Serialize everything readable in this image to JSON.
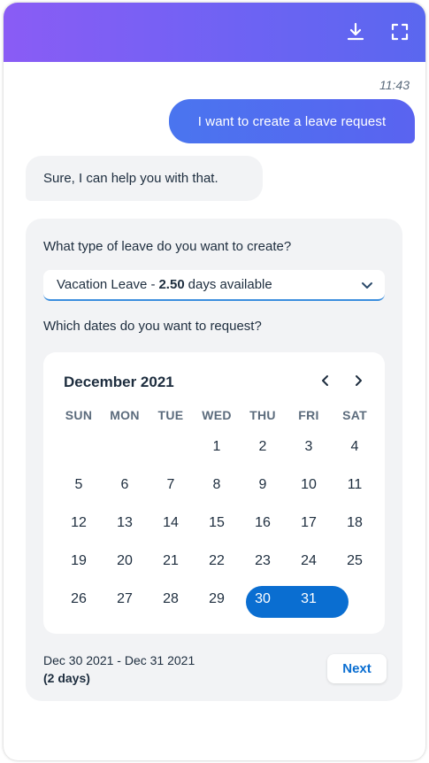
{
  "header": {
    "download_icon": "download-icon",
    "fullscreen_icon": "fullscreen-icon",
    "gradient_start": "#8a5cf5",
    "gradient_end": "#5a67ef"
  },
  "conversation": {
    "timestamp": "11:43",
    "user_message": "I want to create a leave request",
    "bot_message": "Sure, I can help you with that."
  },
  "form": {
    "leave_question": "What type of leave do you want to create?",
    "leave_select": {
      "type": "Vacation Leave -",
      "amount": "2.50",
      "suffix": "days available"
    },
    "dates_question": "Which dates do you want to request?",
    "calendar": {
      "month_label": "December 2021",
      "weekdays": [
        "SUN",
        "MON",
        "TUE",
        "WED",
        "THU",
        "FRI",
        "SAT"
      ],
      "weeks": [
        [
          "",
          "",
          "",
          "1",
          "2",
          "3",
          "4"
        ],
        [
          "5",
          "6",
          "7",
          "8",
          "9",
          "10",
          "11"
        ],
        [
          "12",
          "13",
          "14",
          "15",
          "16",
          "17",
          "18"
        ],
        [
          "19",
          "20",
          "21",
          "22",
          "23",
          "24",
          "25"
        ],
        [
          "26",
          "27",
          "28",
          "29",
          "30",
          "31",
          ""
        ]
      ],
      "selected_days": [
        "30",
        "31"
      ],
      "accent_color": "#0a6ed1"
    },
    "range_text": "Dec 30 2021 - Dec 31 2021",
    "range_days": "(2 days)",
    "next_label": "Next"
  }
}
